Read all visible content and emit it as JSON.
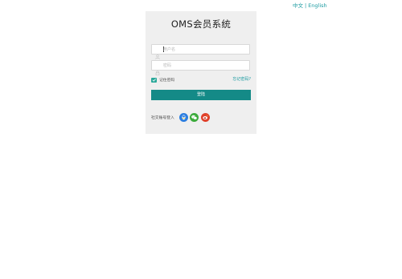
{
  "language_switch": {
    "chinese": "中文",
    "separator": "|",
    "english": "English"
  },
  "login_panel": {
    "title": "OMS会员系统",
    "username": {
      "value": "",
      "placeholder": "用户名",
      "icon": "user-icon"
    },
    "password": {
      "value": "",
      "placeholder": "密码",
      "icon": "lock-icon"
    },
    "remember_me": {
      "label": "记住密码",
      "checked": true
    },
    "forgot_password": "忘记密码?",
    "login_button": "登陆",
    "social_login": {
      "label": "社交账号登入",
      "providers": [
        "qq-icon",
        "wechat-icon",
        "weibo-icon"
      ]
    }
  },
  "colors": {
    "accent": "#148a87",
    "link": "#1a9aa0",
    "checkbox": "#2aa89a",
    "panel_bg": "#efefef",
    "qq": "#2c7ee0",
    "wechat": "#3cab3c",
    "weibo": "#e0402b"
  }
}
